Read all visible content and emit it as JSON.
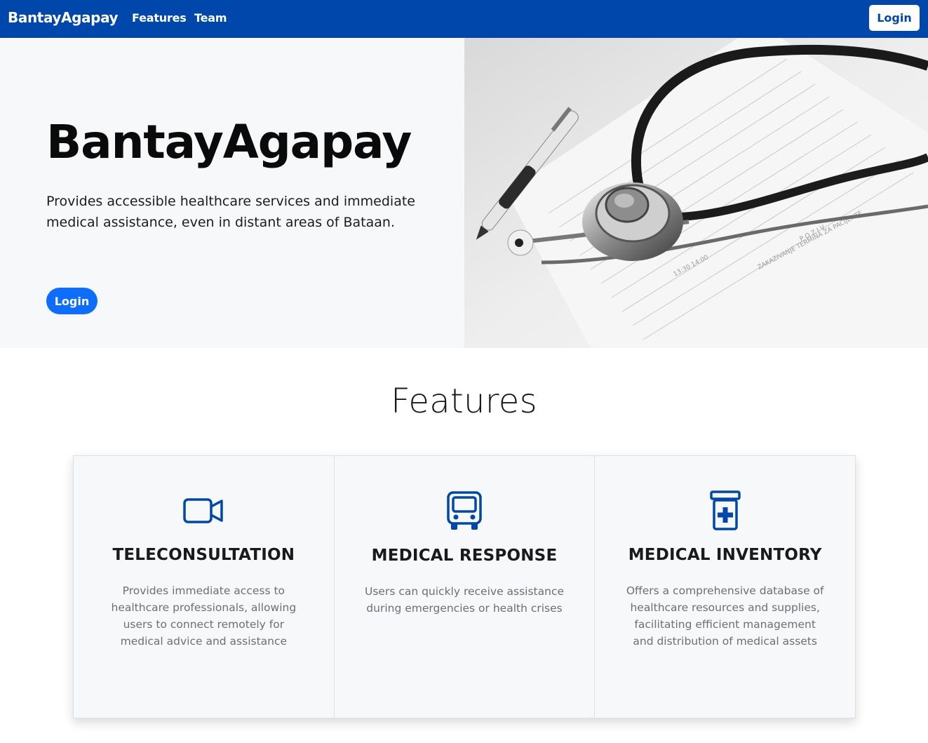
{
  "nav": {
    "brand": "BantayAgapay",
    "links": [
      "Features",
      "Team"
    ],
    "login_label": "Login"
  },
  "hero": {
    "title": "BantayAgapay",
    "description": "Provides accessible healthcare services and immediate medical assistance, even in distant areas of Bataan.",
    "login_label": "Login",
    "image_semantic": "stethoscope-on-medical-form"
  },
  "features": {
    "heading": "Features",
    "cards": [
      {
        "icon": "video-camera-icon",
        "title": "TELECONSULTATION",
        "description": "Provides immediate access to healthcare professionals, allowing users to connect remotely for medical advice and assistance"
      },
      {
        "icon": "bus-icon",
        "title": "MEDICAL RESPONSE",
        "description": "Users can quickly receive assistance during emergencies or health crises"
      },
      {
        "icon": "medicine-bottle-icon",
        "title": "MEDICAL INVENTORY",
        "description": "Offers a comprehensive database of healthcare resources and supplies, facilitating efficient management and distribution of medical assets"
      }
    ]
  },
  "colors": {
    "navbar": "#0047ab",
    "primary_button": "#0d6efd",
    "icon": "#0047ab",
    "hero_bg": "#f7f8fa"
  }
}
